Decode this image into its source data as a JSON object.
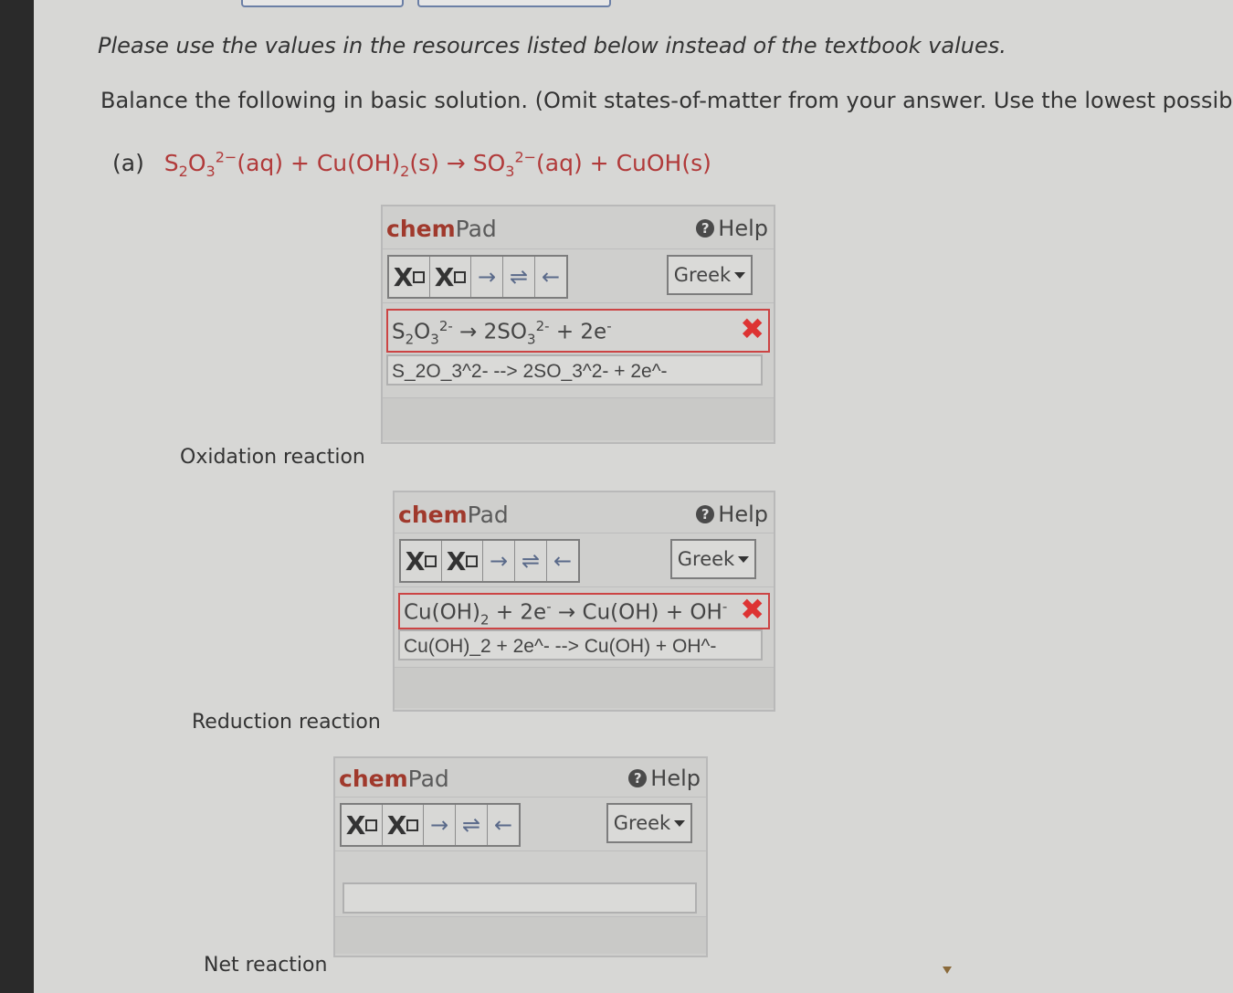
{
  "intro_text": "Please use the values in the resources listed below instead of the textbook values.",
  "instruction_text": "Balance the following in basic solution. (Omit states-of-matter from your answer. Use the lowest possibl",
  "question": {
    "tag": "(a)",
    "equation": {
      "a": "S",
      "a_sub1": "2",
      "b": "O",
      "b_sub": "3",
      "b_sup": "2−",
      "c": "(aq) + Cu(OH)",
      "c_sub": "2",
      "d": "(s) → SO",
      "d_sub": "3",
      "d_sup": "2−",
      "e": "(aq) + CuOH(s)"
    }
  },
  "labels": {
    "oxidation": "Oxidation reaction",
    "reduction": "Reduction reaction",
    "net": "Net reaction"
  },
  "chempad": {
    "brand_bold": "chem",
    "brand_rest": "Pad",
    "help_label": "Help",
    "help_icon": "?",
    "greek_label": "Greek",
    "tool_arrow": "→",
    "tool_equilibrium": "⇌",
    "tool_back": "←",
    "tool_x": "X"
  },
  "pads": {
    "oxidation": {
      "rendered": {
        "p1": "S",
        "p1s": "2",
        "p2": "O",
        "p2s": "3",
        "p2sup": "2-",
        "p3": " → 2SO",
        "p3s": "3",
        "p3sup": "2-",
        "p4": " + 2e",
        "p4sup": "-"
      },
      "input_value": "S_2O_3^2- --> 2SO_3^2- + 2e^-",
      "status_mark": "✖"
    },
    "reduction": {
      "rendered": {
        "p1": "Cu(OH)",
        "p1s": "2",
        "p2": " + 2e",
        "p2sup": "-",
        "p3": " → Cu(OH) + OH",
        "p3sup": "-"
      },
      "input_value": "Cu(OH)_2 + 2e^- --> Cu(OH) + OH^-",
      "status_mark": "✖"
    },
    "net": {
      "input_value": ""
    }
  },
  "colors": {
    "brand_accent": "#a0392c",
    "error_red": "#d33333",
    "equation_red": "#b13a3a"
  }
}
